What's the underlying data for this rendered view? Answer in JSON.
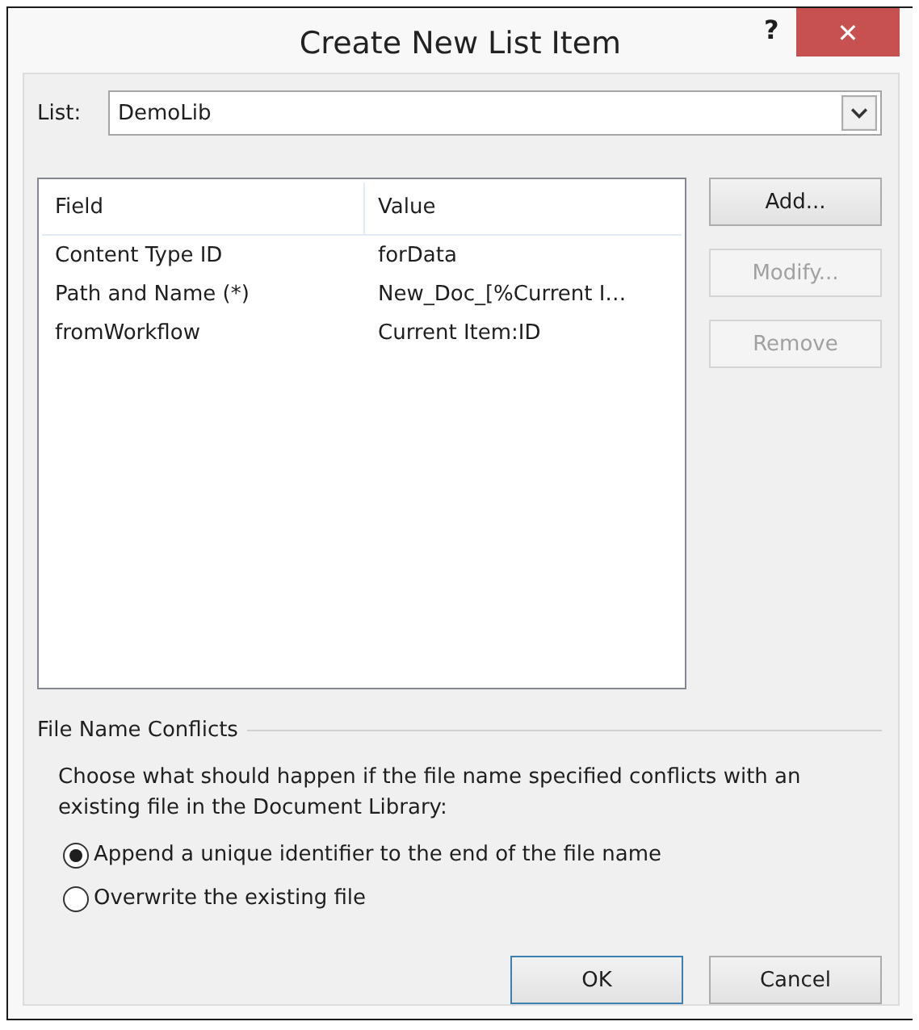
{
  "window": {
    "title": "Create New List Item",
    "help": "?",
    "close": "✕"
  },
  "list": {
    "label": "List:",
    "value": "DemoLib"
  },
  "table": {
    "columns": [
      "Field",
      "Value"
    ],
    "rows": [
      [
        "Content Type ID",
        "forData"
      ],
      [
        "Path and Name (*)",
        "New_Doc_[%Current I…"
      ],
      [
        "fromWorkflow",
        "Current Item:ID"
      ]
    ]
  },
  "side_buttons": [
    {
      "label": "Add...",
      "disabled": false
    },
    {
      "label": "Modify...",
      "disabled": true
    },
    {
      "label": "Remove",
      "disabled": true
    }
  ],
  "conflicts": {
    "title": "File Name Conflicts",
    "description": "Choose what should happen if the file name specified conflicts with an existing file in the Document Library:",
    "options": [
      {
        "label": "Append a unique identifier to the end of the file name",
        "selected": true
      },
      {
        "label": "Overwrite the existing file",
        "selected": false
      }
    ]
  },
  "buttons": [
    {
      "label": "OK",
      "default": true
    },
    {
      "label": "Cancel",
      "default": false
    }
  ]
}
